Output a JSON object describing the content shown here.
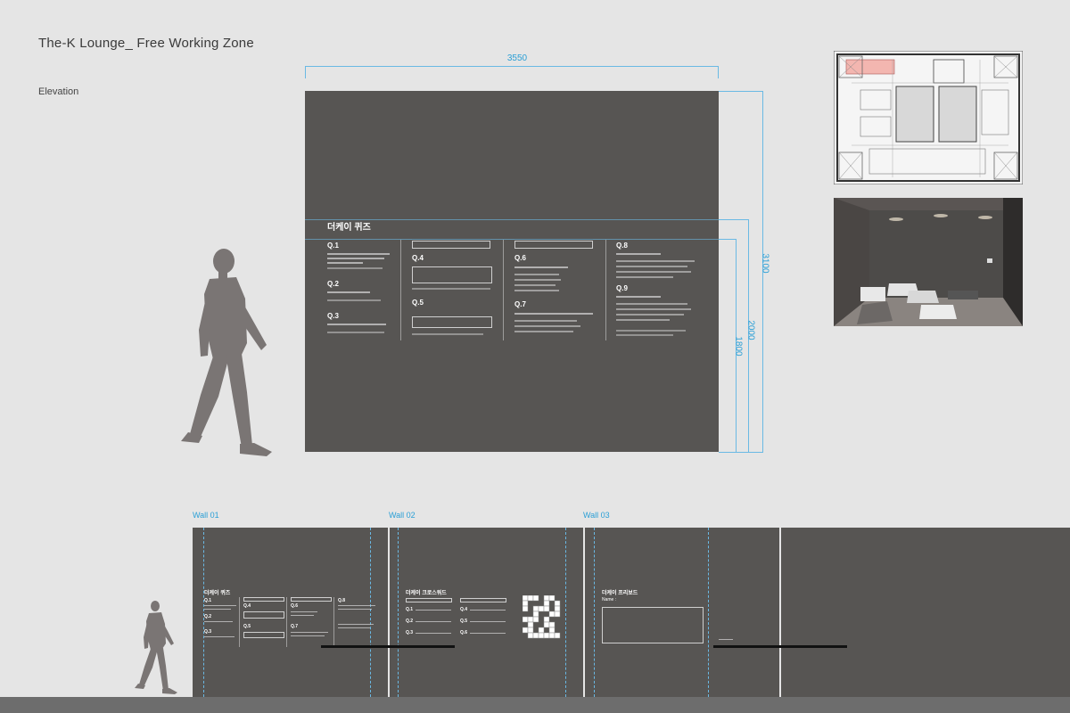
{
  "header": {
    "title": "The-K Lounge_ Free Working Zone",
    "subtitle": "Elevation"
  },
  "dimensions": {
    "width": "3550",
    "height_total": "3100",
    "height_upper": "2000",
    "height_panel": "1800"
  },
  "main_wall": {
    "heading": "더케이 퀴즈",
    "questions": [
      "Q.1",
      "Q.2",
      "Q.3",
      "Q.4",
      "Q.5",
      "Q.6",
      "Q.7",
      "Q.8",
      "Q.9"
    ]
  },
  "walls": [
    {
      "label": "Wall 01",
      "heading": "더케이 퀴즈",
      "questions": [
        "Q.1",
        "Q.2",
        "Q.3",
        "Q.4",
        "Q.5",
        "Q.6",
        "Q.7",
        "Q.8"
      ]
    },
    {
      "label": "Wall 02",
      "heading": "더케이 크로스워드",
      "questions": [
        "Q.1",
        "Q.2",
        "Q.3",
        "Q.4",
        "Q.5",
        "Q.6"
      ]
    },
    {
      "label": "Wall 03",
      "heading": "더케이 프리보드",
      "field_label": "Name :"
    }
  ],
  "colors": {
    "wall": "#575553",
    "dimension": "#2a9fd6",
    "background": "#e5e5e5"
  }
}
